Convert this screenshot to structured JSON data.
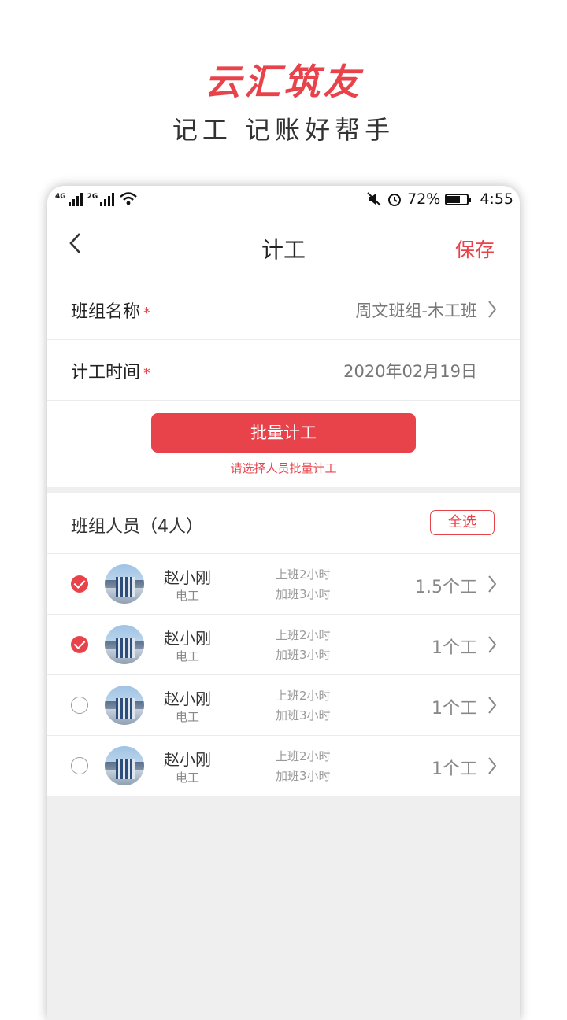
{
  "promo": {
    "title": "云汇筑友",
    "subtitle": "记工  记账好帮手"
  },
  "status": {
    "net1": "4G",
    "net2": "2G",
    "battery_pct": "72%",
    "battery_level": 0.72,
    "time": "4:55"
  },
  "nav": {
    "back_icon": "chevron-left-icon",
    "title": "计工",
    "save": "保存"
  },
  "form": {
    "team": {
      "label": "班组名称",
      "required": "*",
      "value": "周文班组-木工班"
    },
    "date": {
      "label": "计工时间",
      "required": "*",
      "value": "2020年02月19日"
    }
  },
  "batch": {
    "button": "批量计工",
    "hint": "请选择人员批量计工"
  },
  "members": {
    "title": "班组人员（4人）",
    "select_all": "全选",
    "items": [
      {
        "name": "赵小刚",
        "role": "电工",
        "regular": "上班2小时",
        "overtime": "加班3小时",
        "count": "1.5个工",
        "checked": true
      },
      {
        "name": "赵小刚",
        "role": "电工",
        "regular": "上班2小时",
        "overtime": "加班3小时",
        "count": "1个工",
        "checked": true
      },
      {
        "name": "赵小刚",
        "role": "电工",
        "regular": "上班2小时",
        "overtime": "加班3小时",
        "count": "1个工",
        "checked": false
      },
      {
        "name": "赵小刚",
        "role": "电工",
        "regular": "上班2小时",
        "overtime": "加班3小时",
        "count": "1个工",
        "checked": false
      }
    ]
  },
  "colors": {
    "accent": "#e8434b",
    "background": "#efefef"
  }
}
